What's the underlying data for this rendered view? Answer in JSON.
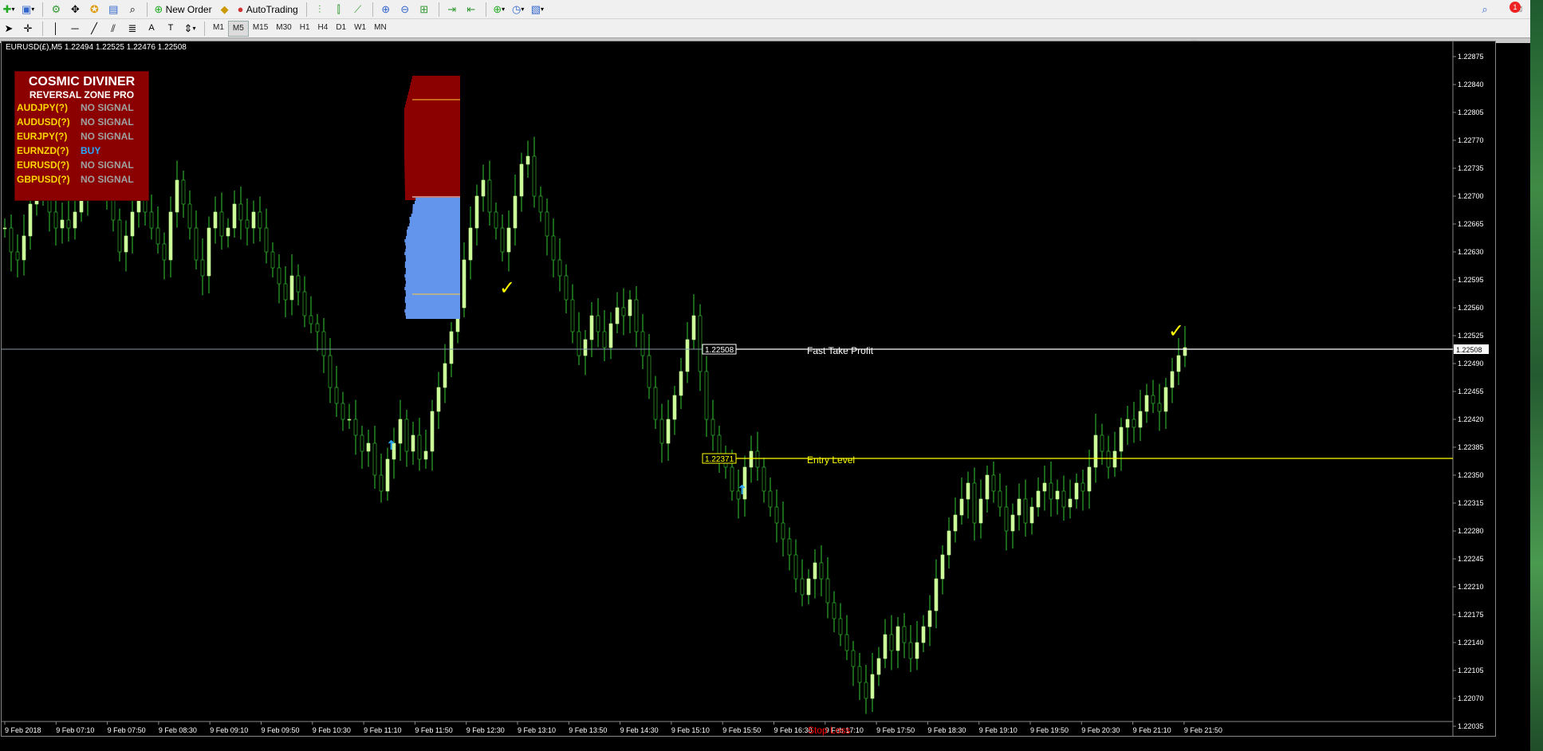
{
  "toolbar": {
    "new_order": "New Order",
    "autotrading": "AutoTrading",
    "timeframes": [
      "M1",
      "M5",
      "M15",
      "M30",
      "H1",
      "H4",
      "D1",
      "W1",
      "MN"
    ],
    "active_timeframe": "M5",
    "notification_count": "1"
  },
  "chart": {
    "header": "EURUSD(£),M5  1.22494 1.22525 1.22476 1.22508",
    "symbol": "EURUSD",
    "timeframe": "M5",
    "current_price": "1.22508",
    "background": "#000000",
    "bull_color": "#ccff99",
    "bear_color": "#000000",
    "wick_color": "#33cc33",
    "y_ticks": [
      "1.22875",
      "1.22840",
      "1.22805",
      "1.22770",
      "1.22735",
      "1.22700",
      "1.22665",
      "1.22630",
      "1.22595",
      "1.22560",
      "1.22525",
      "1.22490",
      "1.22455",
      "1.22420",
      "1.22385",
      "1.22350",
      "1.22315",
      "1.22280",
      "1.22245",
      "1.22210",
      "1.22175",
      "1.22140",
      "1.22105",
      "1.22070",
      "1.22035"
    ],
    "x_ticks": [
      "9 Feb 2018",
      "9 Feb 07:10",
      "9 Feb 07:50",
      "9 Feb 08:30",
      "9 Feb 09:10",
      "9 Feb 09:50",
      "9 Feb 10:30",
      "9 Feb 11:10",
      "9 Feb 11:50",
      "9 Feb 12:30",
      "9 Feb 13:10",
      "9 Feb 13:50",
      "9 Feb 14:30",
      "9 Feb 15:10",
      "9 Feb 15:50",
      "9 Feb 16:30",
      "9 Feb 17:10",
      "9 Feb 17:50",
      "9 Feb 18:30",
      "9 Feb 19:10",
      "9 Feb 19:50",
      "9 Feb 20:30",
      "9 Feb 21:10",
      "9 Feb 21:50"
    ],
    "lines": {
      "take_profit": {
        "label": "Fast Take Profit",
        "price": "1.22508",
        "box": "1.22508",
        "color": "#ffffff"
      },
      "entry": {
        "label": "Entry Level",
        "price": "1.22371",
        "box": "1.22371",
        "color": "#ffff00"
      },
      "stop_loss": {
        "label": "Stop Loss",
        "color": "#ff0000"
      }
    },
    "close_path": [
      1.2266,
      1.2263,
      1.2262,
      1.2265,
      1.2269,
      1.2272,
      1.227,
      1.2268,
      1.2266,
      1.2267,
      1.2266,
      1.2268,
      1.227,
      1.2273,
      1.2276,
      1.2274,
      1.227,
      1.2267,
      1.2263,
      1.2265,
      1.2268,
      1.227,
      1.2268,
      1.2266,
      1.2264,
      1.2262,
      1.2268,
      1.2272,
      1.2269,
      1.2266,
      1.2262,
      1.226,
      1.2266,
      1.2268,
      1.2265,
      1.2266,
      1.2269,
      1.2267,
      1.2266,
      1.2268,
      1.2266,
      1.2263,
      1.2261,
      1.2259,
      1.2257,
      1.226,
      1.2258,
      1.2255,
      1.2254,
      1.2253,
      1.225,
      1.2246,
      1.2244,
      1.2242,
      1.2242,
      1.224,
      1.2238,
      1.2239,
      1.2235,
      1.2233,
      1.2237,
      1.2239,
      1.2242,
      1.2238,
      1.224,
      1.2237,
      1.2238,
      1.2243,
      1.2246,
      1.2249,
      1.2253,
      1.2256,
      1.2262,
      1.2266,
      1.227,
      1.2272,
      1.2268,
      1.2266,
      1.2263,
      1.2266,
      1.227,
      1.2274,
      1.2275,
      1.227,
      1.2268,
      1.2265,
      1.2262,
      1.226,
      1.2257,
      1.2253,
      1.225,
      1.2252,
      1.2255,
      1.2253,
      1.2251,
      1.2254,
      1.2256,
      1.2255,
      1.2257,
      1.2253,
      1.225,
      1.2246,
      1.2242,
      1.2239,
      1.2242,
      1.2245,
      1.2248,
      1.2252,
      1.2255,
      1.2248,
      1.2242,
      1.224,
      1.2237,
      1.2236,
      1.2233,
      1.2232,
      1.2236,
      1.2238,
      1.2236,
      1.2233,
      1.2231,
      1.2229,
      1.2227,
      1.2225,
      1.2222,
      1.222,
      1.2222,
      1.2224,
      1.2222,
      1.2219,
      1.2217,
      1.2215,
      1.2213,
      1.2211,
      1.2209,
      1.2207,
      1.221,
      1.2212,
      1.2215,
      1.2213,
      1.2216,
      1.2214,
      1.2212,
      1.2214,
      1.2216,
      1.2218,
      1.2222,
      1.2225,
      1.2228,
      1.223,
      1.2232,
      1.2234,
      1.2229,
      1.2232,
      1.2235,
      1.2233,
      1.2231,
      1.2228,
      1.223,
      1.2232,
      1.2229,
      1.2231,
      1.2233,
      1.2234,
      1.2232,
      1.2233,
      1.2231,
      1.2232,
      1.2234,
      1.2233,
      1.2236,
      1.224,
      1.2238,
      1.2236,
      1.2238,
      1.2241,
      1.2242,
      1.2241,
      1.2243,
      1.2245,
      1.2244,
      1.2243,
      1.2246,
      1.2248,
      1.225,
      1.2251
    ],
    "arrows": [
      "up-arrow",
      "up-arrow"
    ],
    "checkmarks": [
      "check",
      "check"
    ]
  },
  "panel": {
    "title": "COSMIC DIVINER",
    "subtitle": "REVERSAL ZONE PRO",
    "signals": [
      {
        "pair": "AUDJPY(?)",
        "signal": "NO SIGNAL"
      },
      {
        "pair": "AUDUSD(?)",
        "signal": "NO SIGNAL"
      },
      {
        "pair": "EURJPY(?)",
        "signal": "NO SIGNAL"
      },
      {
        "pair": "EURNZD(?)",
        "signal": "BUY"
      },
      {
        "pair": "EURUSD(?)",
        "signal": "NO SIGNAL"
      },
      {
        "pair": "GBPUSD(?)",
        "signal": "NO SIGNAL"
      }
    ]
  },
  "histogram": {
    "top_color": "#8b0000",
    "bottom_color": "#6495ed"
  }
}
